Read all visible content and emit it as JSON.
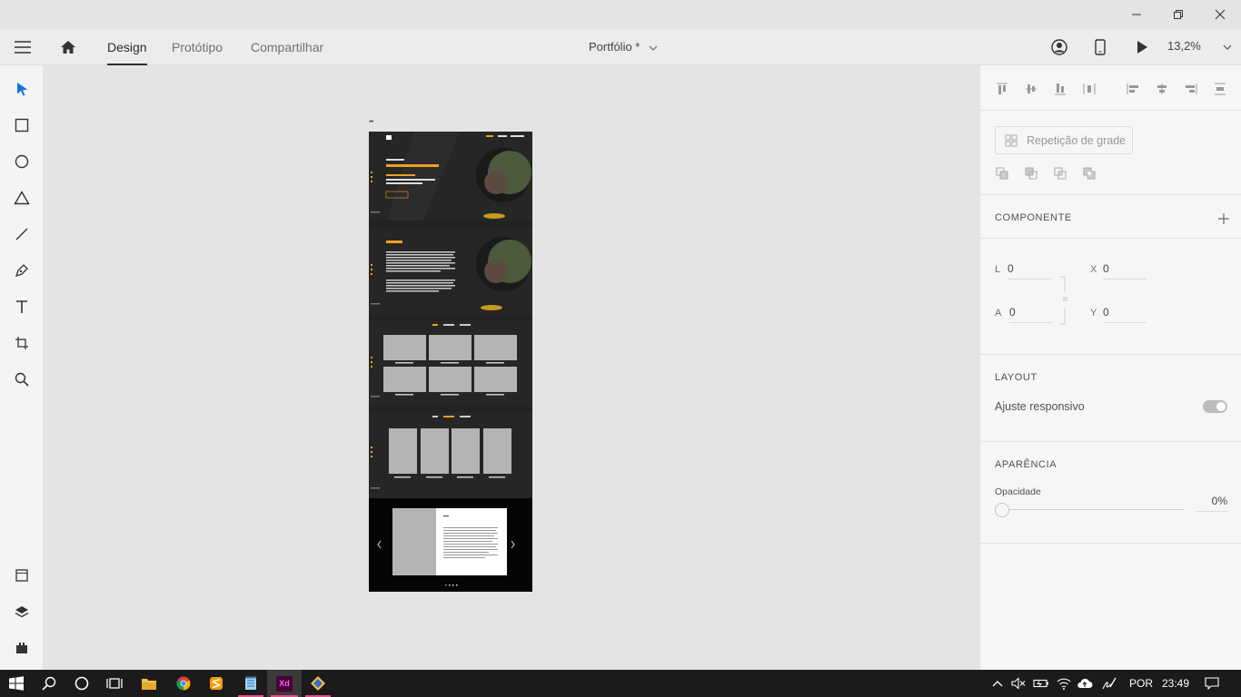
{
  "header": {
    "tabs": [
      {
        "label": "Design"
      },
      {
        "label": "Protótipo"
      },
      {
        "label": "Compartilhar"
      }
    ],
    "document_title": "Portfólio *",
    "zoom": "13,2%"
  },
  "artboard": {
    "hero_greeting": "Olá, eu sou",
    "hero_name": "Eu sou Fabiana Antero",
    "hero_role": "Designer | Ilustração",
    "hero_tagline": "Ser grande consiste em design centrado e o usuário",
    "hero_button": "Entrar em contato",
    "nav_items": [
      "HOME",
      "SOBRE",
      "PORTFÓLIO"
    ],
    "about_title": "SOBRE",
    "gallery_tabs": [
      "WEB",
      "MOBILE",
      "DESIGN"
    ],
    "card_caption": "Nome do projeto",
    "modal_title": "Título"
  },
  "panel": {
    "grid_repeat_label": "Repetição de grade",
    "component_title": "COMPONENTE",
    "dimensions": {
      "width_label": "L",
      "width_value": "0",
      "height_label": "A",
      "height_value": "0",
      "x_label": "X",
      "x_value": "0",
      "y_label": "Y",
      "y_value": "0"
    },
    "layout_title": "LAYOUT",
    "responsive_label": "Ajuste responsivo",
    "appearance_title": "APARÊNCIA",
    "opacity_label": "Opacidade",
    "opacity_value": "0%"
  },
  "taskbar": {
    "language": "POR",
    "time": "23:49",
    "xd_label": "Xd"
  },
  "colors": {
    "accent": "#1473e6",
    "artboard_accent": "#f0a020",
    "xd_brand": "#470137",
    "xd_text": "#ff61f6"
  }
}
